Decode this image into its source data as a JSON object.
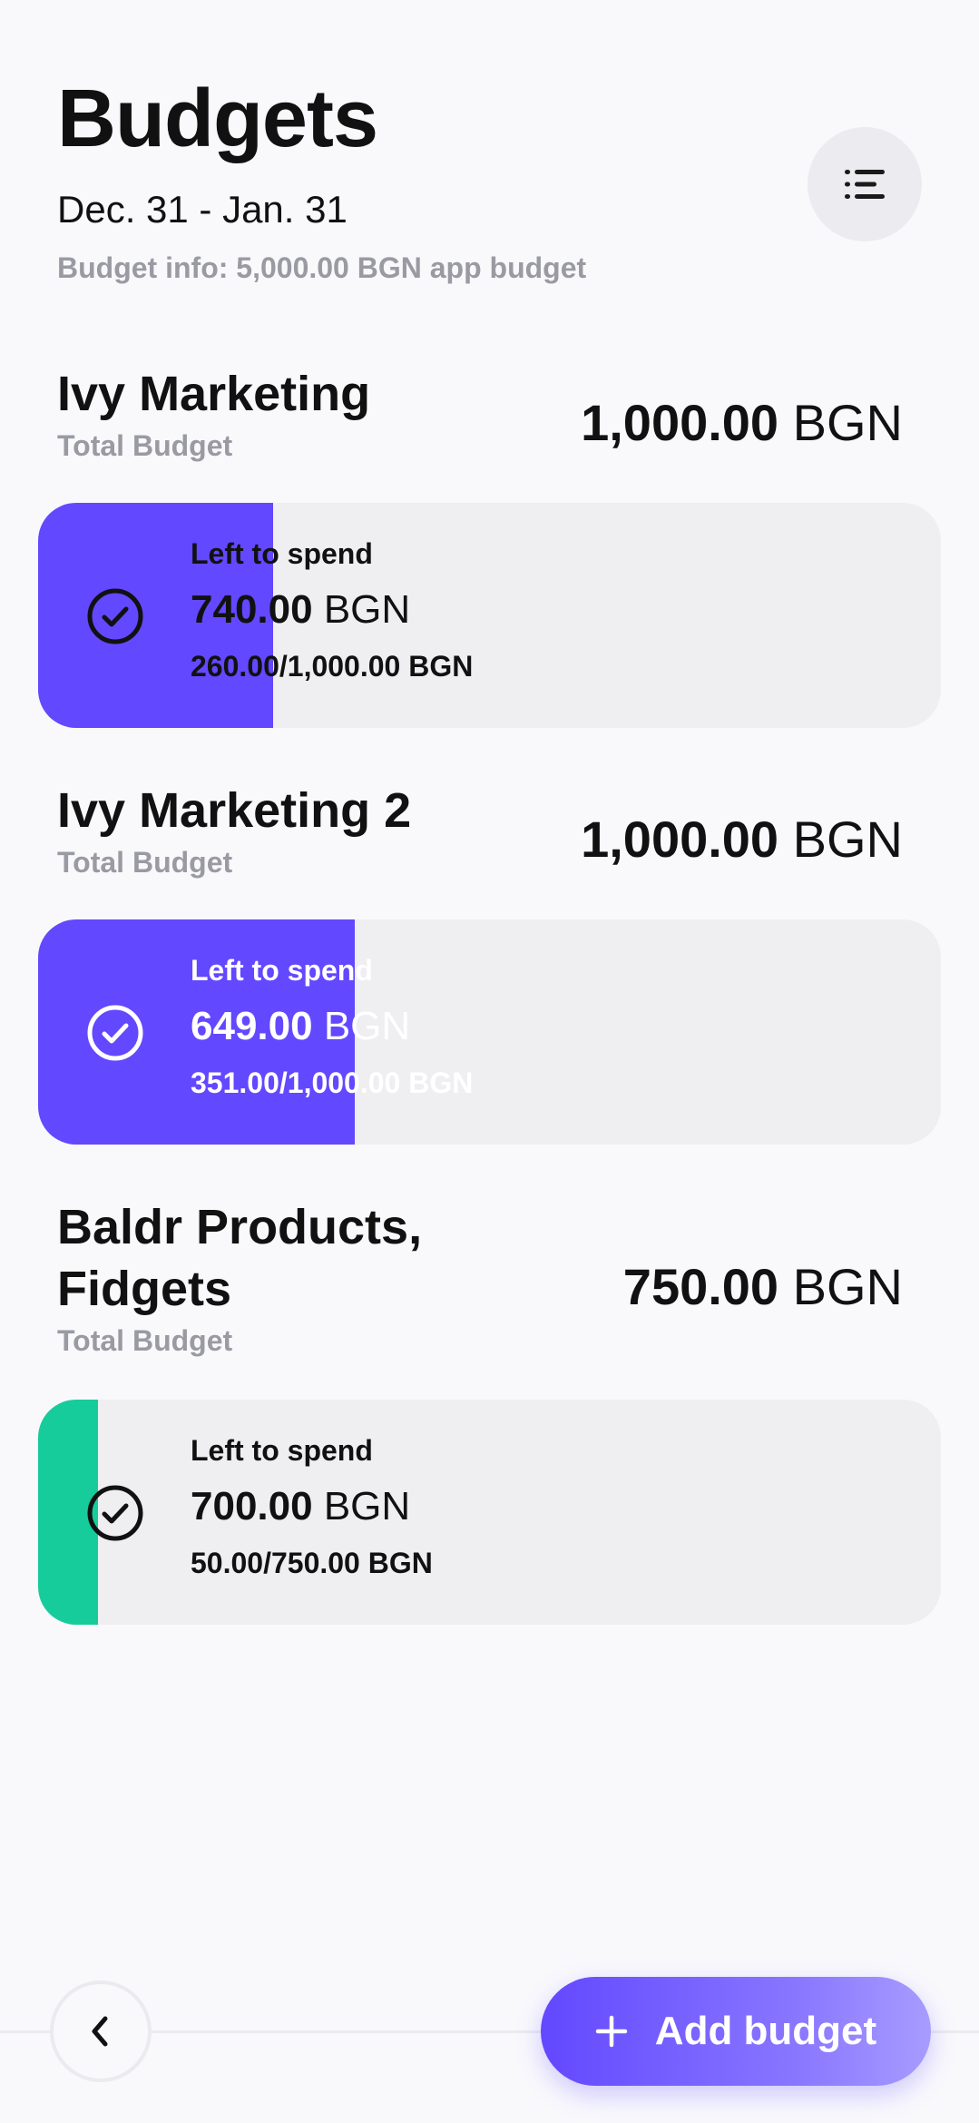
{
  "header": {
    "title": "Budgets",
    "period": "Dec. 31 - Jan. 31",
    "budget_info": "Budget info: 5,000.00 BGN app budget",
    "menu_icon": "sort-list-icon"
  },
  "budgets": [
    {
      "name": "Ivy Marketing",
      "sub_label": "Total Budget",
      "total_amount": "1,000.00",
      "total_currency": "BGN",
      "left_label": "Left to spend",
      "left_amount": "740.00",
      "left_currency": "BGN",
      "spent_text": "260.00/1,000.00 BGN",
      "fill_fraction": 0.26,
      "fill_color": "#6248ff",
      "status_icon": "check-circle-icon"
    },
    {
      "name": "Ivy Marketing 2",
      "sub_label": "Total Budget",
      "total_amount": "1,000.00",
      "total_currency": "BGN",
      "left_label": "Left to spend",
      "left_amount": "649.00",
      "left_currency": "BGN",
      "spent_text": "351.00/1,000.00 BGN",
      "fill_fraction": 0.351,
      "fill_color": "#6248ff",
      "status_icon": "check-circle-icon"
    },
    {
      "name": "Baldr Products, Fidgets",
      "sub_label": "Total Budget",
      "total_amount": "750.00",
      "total_currency": "BGN",
      "left_label": "Left to spend",
      "left_amount": "700.00",
      "left_currency": "BGN",
      "spent_text": "50.00/750.00 BGN",
      "fill_fraction": 0.0667,
      "fill_color": "#16cc9a",
      "status_icon": "check-circle-icon"
    }
  ],
  "footer": {
    "back_icon": "chevron-left-icon",
    "add_icon": "plus-icon",
    "add_label": "Add budget"
  },
  "colors": {
    "accent": "#6248ff",
    "green": "#16cc9a",
    "background": "#f9f9fc",
    "card": "#efeff2",
    "muted_text": "#9a9aa3"
  }
}
